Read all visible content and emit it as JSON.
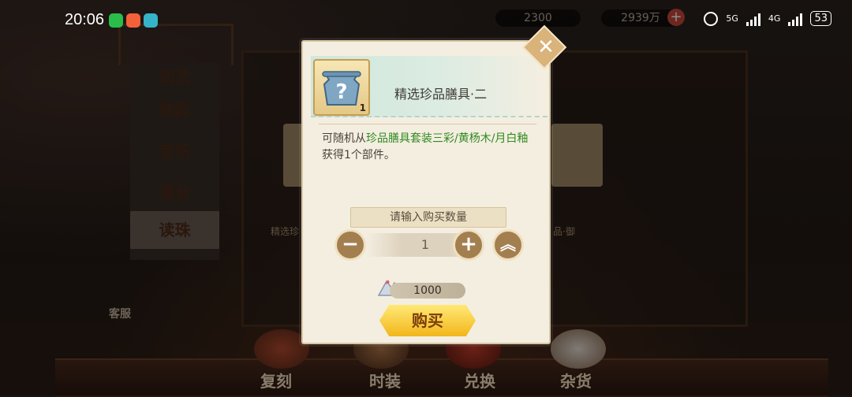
{
  "status_bar": {
    "time": "20:06",
    "network_1": "5G",
    "network_2": "4G",
    "battery": "53",
    "app_icons": [
      "wechat-icon",
      "weibo-icon",
      "game-app-icon"
    ]
  },
  "resources": {
    "currency_1": "2300",
    "currency_2": "2939万",
    "add_label": "+"
  },
  "left_menu": {
    "items": [
      {
        "label": "四艺"
      },
      {
        "label": "牌弈"
      },
      {
        "label": "音乐"
      },
      {
        "label": "擂台"
      },
      {
        "label": "读珠"
      }
    ],
    "customer_service": "客服"
  },
  "stage": {
    "card_left_caption": "精选珍",
    "card_right_caption": "品·御"
  },
  "bottom_tabs": [
    {
      "label": "复刻"
    },
    {
      "label": "时装"
    },
    {
      "label": "兑换"
    },
    {
      "label": "杂货"
    }
  ],
  "modal": {
    "item_name": "精选珍品膳具·二",
    "item_count": "1",
    "description_prefix": "可随机从",
    "description_highlight": "珍品膳具套装三彩/黄杨木/月白釉",
    "description_suffix": "获得1个部件。",
    "quantity_prompt": "请输入购买数量",
    "quantity_value": "1",
    "minus_label": "−",
    "plus_label": "+",
    "max_label": "︽",
    "price": "1000",
    "buy_label": "购买",
    "close_label": "✕"
  },
  "colors": {
    "modal_bg": "#f4eee1",
    "highlight_green": "#2f8a1e",
    "buy_gold": "#f2b61b"
  }
}
